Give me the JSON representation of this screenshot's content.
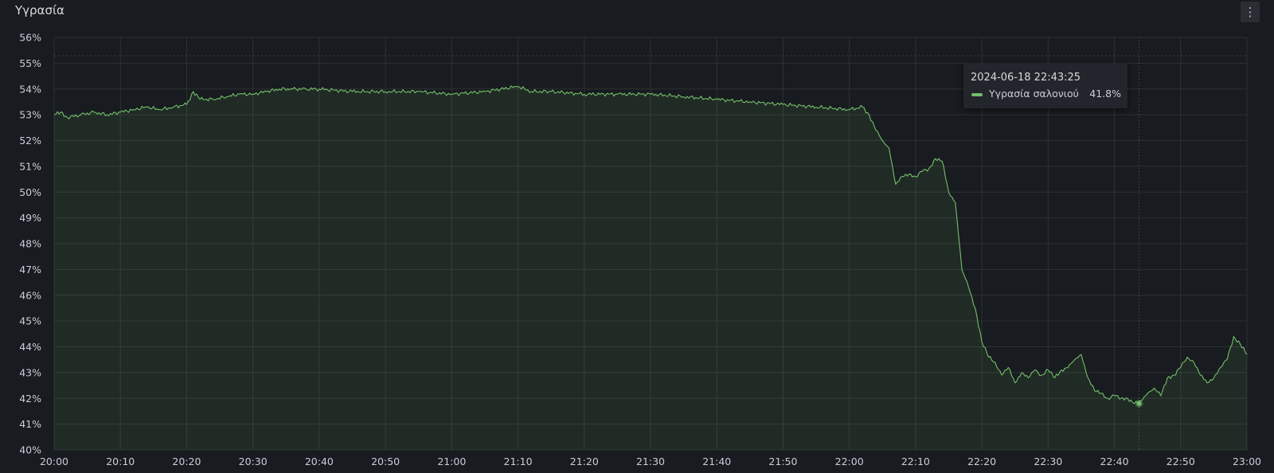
{
  "panel": {
    "title": "Υγρασία",
    "menu_icon": "vertical-ellipsis-icon"
  },
  "tooltip": {
    "time": "2024-06-18 22:43:25",
    "series_name": "Υγρασία σαλονιού",
    "value": "41.8%"
  },
  "colors": {
    "background": "#181b1f",
    "series": "#73bf69",
    "grid": "#2c3235",
    "axis_text": "#ccccdc"
  },
  "chart_data": {
    "type": "area",
    "title": "Υγρασία",
    "xlabel": "",
    "ylabel": "",
    "y_unit": "%",
    "ylim": [
      40,
      56
    ],
    "y_ticks": [
      "40%",
      "41%",
      "42%",
      "43%",
      "44%",
      "45%",
      "46%",
      "47%",
      "48%",
      "49%",
      "50%",
      "51%",
      "52%",
      "53%",
      "54%",
      "55%",
      "56%"
    ],
    "xlim": [
      "20:00",
      "23:00"
    ],
    "x_ticks": [
      "20:00",
      "20:10",
      "20:20",
      "20:30",
      "20:40",
      "20:50",
      "21:00",
      "21:10",
      "21:20",
      "21:30",
      "21:40",
      "21:50",
      "22:00",
      "22:10",
      "22:20",
      "22:30",
      "22:40",
      "22:50",
      "23:00"
    ],
    "grid": true,
    "series": [
      {
        "name": "Υγρασία σαλονιού",
        "color": "#73bf69",
        "x": [
          "20:00",
          "20:01",
          "20:02",
          "20:04",
          "20:06",
          "20:08",
          "20:10",
          "20:12",
          "20:14",
          "20:16",
          "20:18",
          "20:20",
          "20:21",
          "20:22",
          "20:24",
          "20:26",
          "20:28",
          "20:30",
          "20:32",
          "20:34",
          "20:36",
          "20:38",
          "20:40",
          "20:45",
          "20:50",
          "20:55",
          "21:00",
          "21:05",
          "21:10",
          "21:12",
          "21:15",
          "21:20",
          "21:25",
          "21:30",
          "21:35",
          "21:40",
          "21:45",
          "21:50",
          "21:55",
          "22:00",
          "22:02",
          "22:03",
          "22:04",
          "22:05",
          "22:06",
          "22:07",
          "22:08",
          "22:09",
          "22:10",
          "22:11",
          "22:12",
          "22:13",
          "22:14",
          "22:15",
          "22:16",
          "22:17",
          "22:18",
          "22:19",
          "22:20",
          "22:21",
          "22:22",
          "22:23",
          "22:24",
          "22:25",
          "22:26",
          "22:27",
          "22:28",
          "22:29",
          "22:30",
          "22:31",
          "22:32",
          "22:33",
          "22:34",
          "22:35",
          "22:36",
          "22:37",
          "22:38",
          "22:39",
          "22:40",
          "22:41",
          "22:42",
          "22:43",
          "22:44",
          "22:45",
          "22:46",
          "22:47",
          "22:48",
          "22:49",
          "22:50",
          "22:51",
          "22:52",
          "22:53",
          "22:54",
          "22:55",
          "22:56",
          "22:57",
          "22:58",
          "22:59",
          "23:00"
        ],
        "values": [
          53.0,
          53.1,
          52.9,
          53.0,
          53.1,
          53.0,
          53.1,
          53.2,
          53.3,
          53.2,
          53.3,
          53.4,
          53.9,
          53.6,
          53.6,
          53.7,
          53.8,
          53.8,
          53.9,
          54.0,
          54.0,
          54.0,
          54.0,
          53.9,
          53.9,
          53.9,
          53.8,
          53.9,
          54.1,
          53.9,
          53.9,
          53.8,
          53.8,
          53.8,
          53.7,
          53.6,
          53.5,
          53.4,
          53.3,
          53.2,
          53.3,
          53.0,
          52.4,
          52.0,
          51.7,
          50.3,
          50.6,
          50.7,
          50.6,
          50.8,
          50.9,
          51.3,
          51.2,
          50.0,
          49.6,
          47.0,
          46.3,
          45.5,
          44.2,
          43.6,
          43.4,
          42.9,
          43.2,
          42.6,
          43.0,
          42.8,
          43.1,
          42.9,
          43.1,
          42.8,
          43.1,
          43.2,
          43.5,
          43.7,
          42.8,
          42.3,
          42.2,
          42.0,
          42.1,
          42.0,
          42.0,
          41.8,
          41.9,
          42.2,
          42.4,
          42.1,
          42.8,
          42.9,
          43.2,
          43.6,
          43.4,
          42.9,
          42.6,
          42.8,
          43.2,
          43.5,
          44.4,
          44.1,
          43.7
        ]
      }
    ],
    "highlight": {
      "x": "22:43",
      "y": 41.8
    }
  }
}
